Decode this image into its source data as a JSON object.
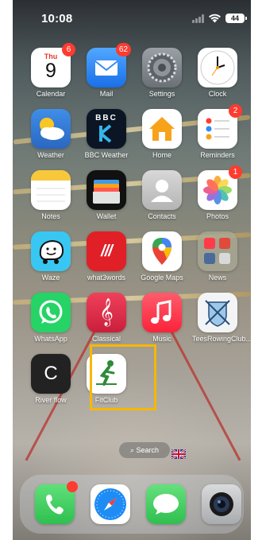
{
  "status_bar": {
    "time": "10:08",
    "battery": "44"
  },
  "apps": {
    "calendar": {
      "label": "Calendar",
      "weekday": "Thu",
      "day": "9",
      "badge": "6"
    },
    "mail": {
      "label": "Mail",
      "badge": "62"
    },
    "settings": {
      "label": "Settings"
    },
    "clock": {
      "label": "Clock"
    },
    "weather": {
      "label": "Weather"
    },
    "bbc_weather": {
      "label": "BBC Weather",
      "logo": "BBC"
    },
    "home": {
      "label": "Home"
    },
    "reminders": {
      "label": "Reminders",
      "badge": "2"
    },
    "notes": {
      "label": "Notes"
    },
    "wallet": {
      "label": "Wallet"
    },
    "contacts": {
      "label": "Contacts"
    },
    "photos": {
      "label": "Photos",
      "badge": "1"
    },
    "waze": {
      "label": "Waze"
    },
    "what3words": {
      "label": "what3words",
      "glyph": "///"
    },
    "google_maps": {
      "label": "Google Maps"
    },
    "news": {
      "label": "News"
    },
    "whatsapp": {
      "label": "WhatsApp"
    },
    "classical": {
      "label": "Classical"
    },
    "music": {
      "label": "Music"
    },
    "tees_rowing": {
      "label": "TeesRowingClub..."
    },
    "river_flow": {
      "label": "River flow",
      "glyph": "C"
    },
    "fitclub": {
      "label": "FitClub"
    }
  },
  "search": {
    "label": "Search"
  },
  "dock": [
    {
      "name": "phone",
      "icon": "phone-icon"
    },
    {
      "name": "safari",
      "icon": "compass-icon"
    },
    {
      "name": "messages",
      "icon": "speech-bubble-icon"
    },
    {
      "name": "camera",
      "icon": "camera-lens-icon"
    }
  ],
  "colors": {
    "highlight": "#f5b800",
    "badge": "#ff3b30",
    "mail": "#2f8cf5",
    "weather": "#3d7fd6",
    "whatsapp": "#25d366",
    "music": "#fc3c44",
    "classical": "#e8324a",
    "what3words": "#e11f26",
    "messages": "#34c759",
    "phone": "#34c759"
  }
}
